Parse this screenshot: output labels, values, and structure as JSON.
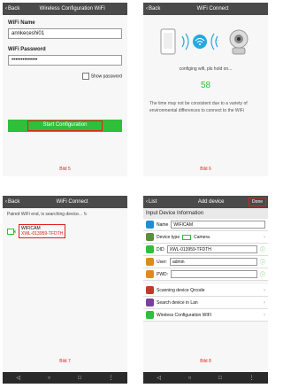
{
  "panel1": {
    "back": "Back",
    "title": "Wireless Configuration WiFi",
    "wifi_name_label": "WiFi Name",
    "wifi_name_value": "annkeceshi01",
    "wifi_password_label": "WiFi Password",
    "wifi_password_value": "••••••••••••••",
    "show_password_label": "Show password",
    "start_button": "Start Configuration",
    "bild": "Bild 5"
  },
  "panel2": {
    "back": "Back",
    "title": "WiFi Connect",
    "status": "configing wifi, pls hold on...",
    "countdown": "58",
    "note": "The time may not be consistent due to a variety of environmental differences to connect to the WiFi",
    "bild": "Bild 6"
  },
  "panel3": {
    "back": "Back",
    "title": "WiFi Connect",
    "searching": "Paired WiFi end, is searching device...",
    "device_name": "WIFICAM",
    "device_id": "XWL-013959-TFDTH",
    "bild": "Bild 7"
  },
  "panel4": {
    "back": "List",
    "title": "Add device",
    "done": "Done",
    "section": "Input Device Information",
    "name_label": "Name",
    "name_value": "WIFICAM",
    "device_type_label": "Device type",
    "device_type_value": "Camera",
    "did_label": "DID",
    "did_value": "XWL-013959-TFDTH",
    "user_label": "User:",
    "user_value": "admin",
    "pwd_label": "PWD:",
    "scan_label": "Scanning device Qrcode",
    "search_label": "Search device in Lan",
    "wireless_label": "Wireless Configuration WIFI",
    "bild": "Bild 8"
  },
  "nav": {
    "back": "◁",
    "home": "○",
    "recent": "□",
    "menu": "⋮"
  }
}
